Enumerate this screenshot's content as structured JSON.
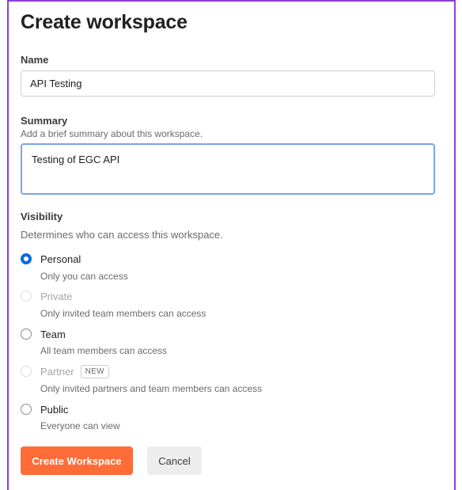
{
  "page": {
    "title": "Create workspace"
  },
  "name": {
    "label": "Name",
    "value": "API Testing"
  },
  "summary": {
    "label": "Summary",
    "help": "Add a brief summary about this workspace.",
    "value": "Testing of EGC API"
  },
  "visibility": {
    "label": "Visibility",
    "help": "Determines who can access this workspace.",
    "selected": "personal",
    "options": [
      {
        "id": "personal",
        "label": "Personal",
        "description": "Only you can access",
        "disabled": false
      },
      {
        "id": "private",
        "label": "Private",
        "description": "Only invited team members can access",
        "disabled": true
      },
      {
        "id": "team",
        "label": "Team",
        "description": "All team members can access",
        "disabled": false
      },
      {
        "id": "partner",
        "label": "Partner",
        "badge": "NEW",
        "description": "Only invited partners and team members can access",
        "disabled": true
      },
      {
        "id": "public",
        "label": "Public",
        "description": "Everyone can view",
        "disabled": false
      }
    ]
  },
  "actions": {
    "create": "Create Workspace",
    "cancel": "Cancel"
  },
  "colors": {
    "primary": "#ff6c37",
    "radio_selected": "#0b6bd9",
    "focus_border": "#7aa7e6",
    "frame": "#8a3fd6"
  }
}
